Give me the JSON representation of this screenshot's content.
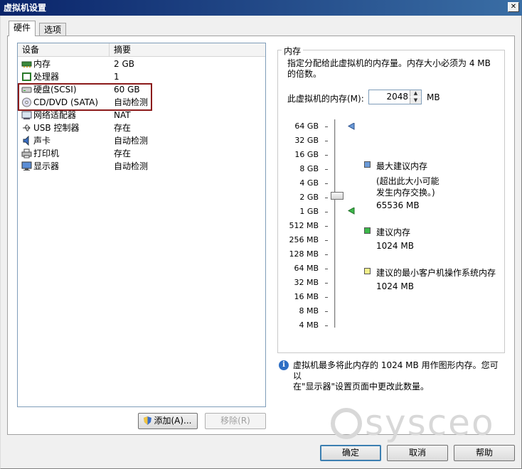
{
  "window": {
    "title": "虚拟机设置",
    "close": "✕"
  },
  "tabs": [
    {
      "label": "硬件"
    },
    {
      "label": "选项"
    }
  ],
  "device_list": {
    "headers": {
      "device": "设备",
      "summary": "摘要"
    },
    "rows": [
      {
        "device": "内存",
        "summary": "2 GB",
        "icon": "memory-icon"
      },
      {
        "device": "处理器",
        "summary": "1",
        "icon": "processor-icon"
      },
      {
        "device": "硬盘(SCSI)",
        "summary": "60 GB",
        "icon": "hard-disk-icon"
      },
      {
        "device": "CD/DVD (SATA)",
        "summary": "自动检测",
        "icon": "cd-dvd-icon"
      },
      {
        "device": "网络适配器",
        "summary": "NAT",
        "icon": "network-adapter-icon"
      },
      {
        "device": "USB 控制器",
        "summary": "存在",
        "icon": "usb-icon"
      },
      {
        "device": "声卡",
        "summary": "自动检测",
        "icon": "sound-card-icon"
      },
      {
        "device": "打印机",
        "summary": "存在",
        "icon": "printer-icon"
      },
      {
        "device": "显示器",
        "summary": "自动检测",
        "icon": "display-icon"
      }
    ]
  },
  "buttons": {
    "add": "添加(A)...",
    "remove": "移除(R)",
    "ok": "确定",
    "cancel": "取消",
    "help": "帮助"
  },
  "memory": {
    "group_title": "内存",
    "description": "指定分配给此虚拟机的内存量。内存大小必须为 4 MB 的倍数。",
    "field_label": "此虚拟机的内存(M):",
    "value": "2048",
    "unit": "MB",
    "scale": [
      "64 GB",
      "32 GB",
      "16 GB",
      "8 GB",
      "4 GB",
      "2 GB",
      "1 GB",
      "512 MB",
      "256 MB",
      "128 MB",
      "64 MB",
      "32 MB",
      "16 MB",
      "8 MB",
      "4 MB"
    ],
    "legend": {
      "max_title": "最大建议内存",
      "max_note_1": "(超出此大小可能",
      "max_note_2": "发生内存交换。)",
      "max_value": "65536 MB",
      "rec_title": "建议内存",
      "rec_value": "1024 MB",
      "min_title": "建议的最小客户机操作系统内存",
      "min_value": "1024 MB"
    },
    "colors": {
      "max": "#6a9ad8",
      "rec": "#3cb84a",
      "min": "#f2ef8a"
    },
    "info_line1": "虚拟机最多将此内存的 1024 MB 用作图形内存。您可以",
    "info_line2": "在\"显示器\"设置页面中更改此数量。"
  },
  "watermark": "sysceo"
}
